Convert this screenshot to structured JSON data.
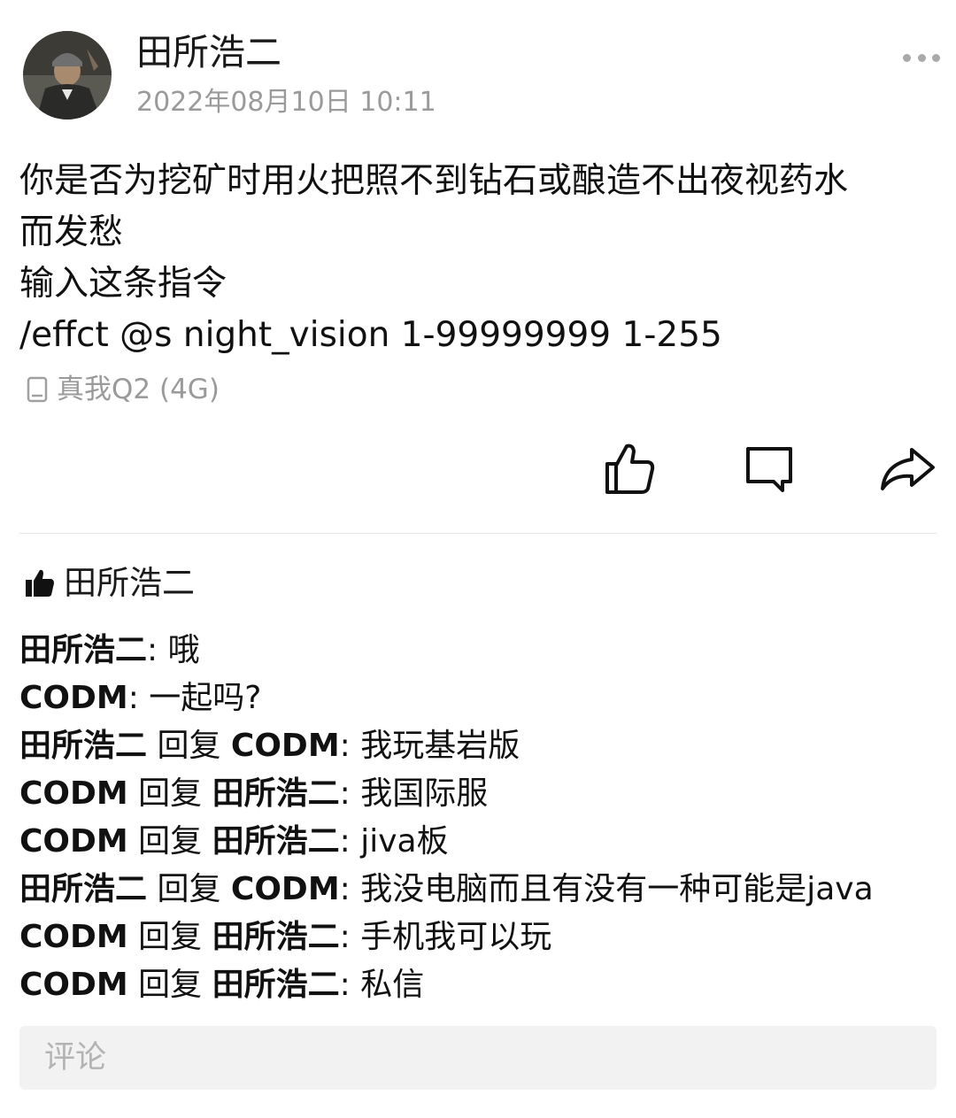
{
  "post": {
    "author": "田所浩二",
    "timestamp": "2022年08月10日 10:11",
    "body_lines": [
      "你是否为挖矿时用火把照不到钻石或酿造不出夜视药水",
      "而发愁",
      "输入这条指令",
      "/effct @s  night_vision 1-99999999 1-255"
    ],
    "device": "真我Q2 (4G)"
  },
  "actions": {
    "like_icon": "thumbs-up-icon",
    "comment_icon": "comment-icon",
    "share_icon": "share-icon",
    "more_icon": "more-icon"
  },
  "likes": {
    "icon": "thumbs-up-filled-icon",
    "names": "田所浩二"
  },
  "comments": [
    {
      "from": "田所浩二",
      "reply_word": "",
      "to": "",
      "text": ": 哦"
    },
    {
      "from": "CODM",
      "reply_word": "",
      "to": "",
      "text": ": 一起吗?"
    },
    {
      "from": "田所浩二",
      "reply_word": " 回复 ",
      "to": "CODM",
      "text": ": 我玩基岩版"
    },
    {
      "from": "CODM",
      "reply_word": " 回复 ",
      "to": "田所浩二",
      "text": ": 我国际服"
    },
    {
      "from": "CODM",
      "reply_word": " 回复 ",
      "to": "田所浩二",
      "text": ": jiva板"
    },
    {
      "from": "田所浩二",
      "reply_word": " 回复 ",
      "to": "CODM",
      "text": ": 我没电脑而且有没有一种可能是java"
    },
    {
      "from": "CODM",
      "reply_word": " 回复 ",
      "to": "田所浩二",
      "text": ": 手机我可以玩"
    },
    {
      "from": "CODM",
      "reply_word": " 回复 ",
      "to": "田所浩二",
      "text": ": 私信"
    }
  ],
  "comment_input": {
    "placeholder": "评论"
  },
  "colors": {
    "text": "#111111",
    "muted": "#9a9a9a",
    "input_bg": "#f2f2f2",
    "divider": "#e6e6e6"
  }
}
